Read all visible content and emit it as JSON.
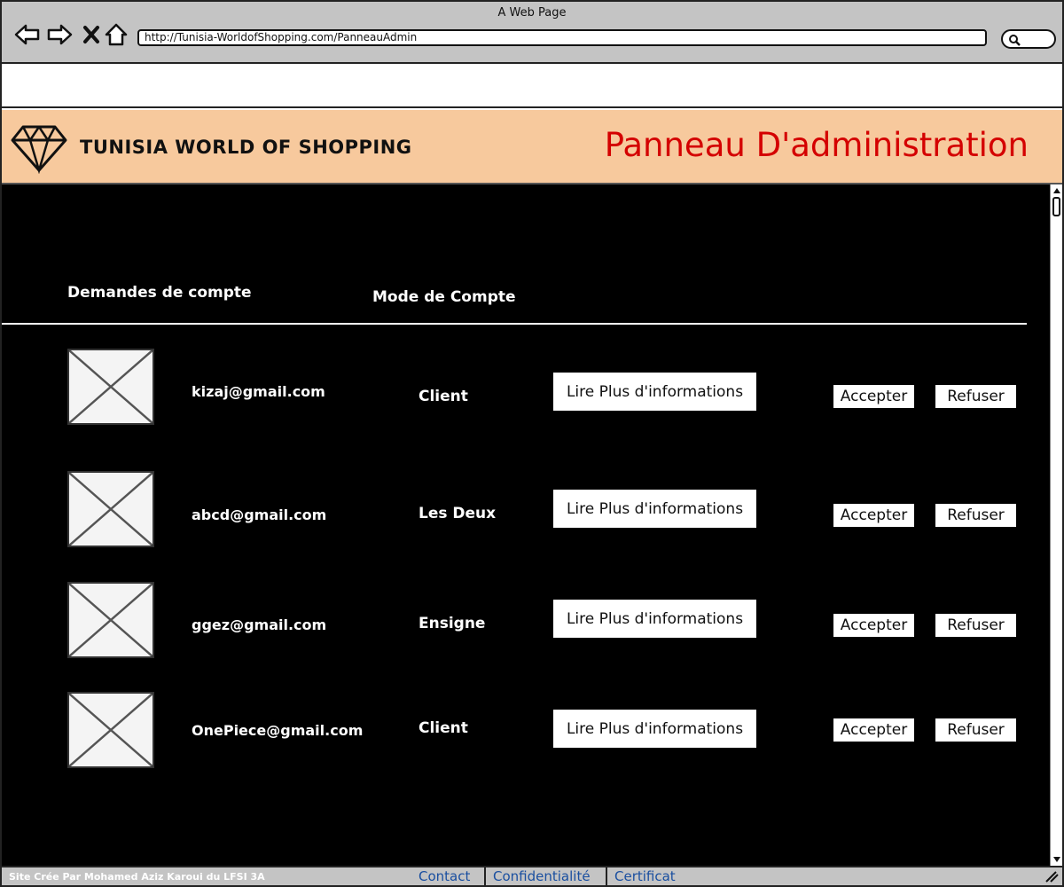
{
  "window": {
    "title": "A Web Page"
  },
  "browser": {
    "url": "http://Tunisia-WorldofShopping.com/PanneauAdmin",
    "nav": [
      "back-icon",
      "forward-icon",
      "stop-icon",
      "home-icon"
    ]
  },
  "header": {
    "brand": "TUNISIA WORLD OF SHOPPING",
    "logo_icon": "diamond-icon",
    "page_title": "Panneau D'administration",
    "background": "#f7c99d",
    "title_color": "#d40000"
  },
  "table": {
    "headers": {
      "requests": "Demandes de compte",
      "mode": "Mode de Compte"
    },
    "rows": [
      {
        "email": "kizaj@gmail.com",
        "mode": "Client",
        "more": "Lire Plus d'informations",
        "accept": "Accepter",
        "refuse": "Refuser"
      },
      {
        "email": "abcd@gmail.com",
        "mode": "Les Deux",
        "more": "Lire Plus d'informations",
        "accept": "Accepter",
        "refuse": "Refuser"
      },
      {
        "email": "ggez@gmail.com",
        "mode": "Ensigne",
        "more": "Lire Plus d'informations",
        "accept": "Accepter",
        "refuse": "Refuser"
      },
      {
        "email": "OnePiece@gmail.com",
        "mode": "Client",
        "more": "Lire Plus d'informations",
        "accept": "Accepter",
        "refuse": "Refuser"
      }
    ]
  },
  "footer": {
    "credit": "Site Crée Par Mohamed Aziz Karoui du LFSI 3A",
    "links": {
      "contact": "Contact",
      "privacy": "Confidentialité",
      "certificate": "Certificat"
    },
    "link_color": "#1a4fa0"
  }
}
